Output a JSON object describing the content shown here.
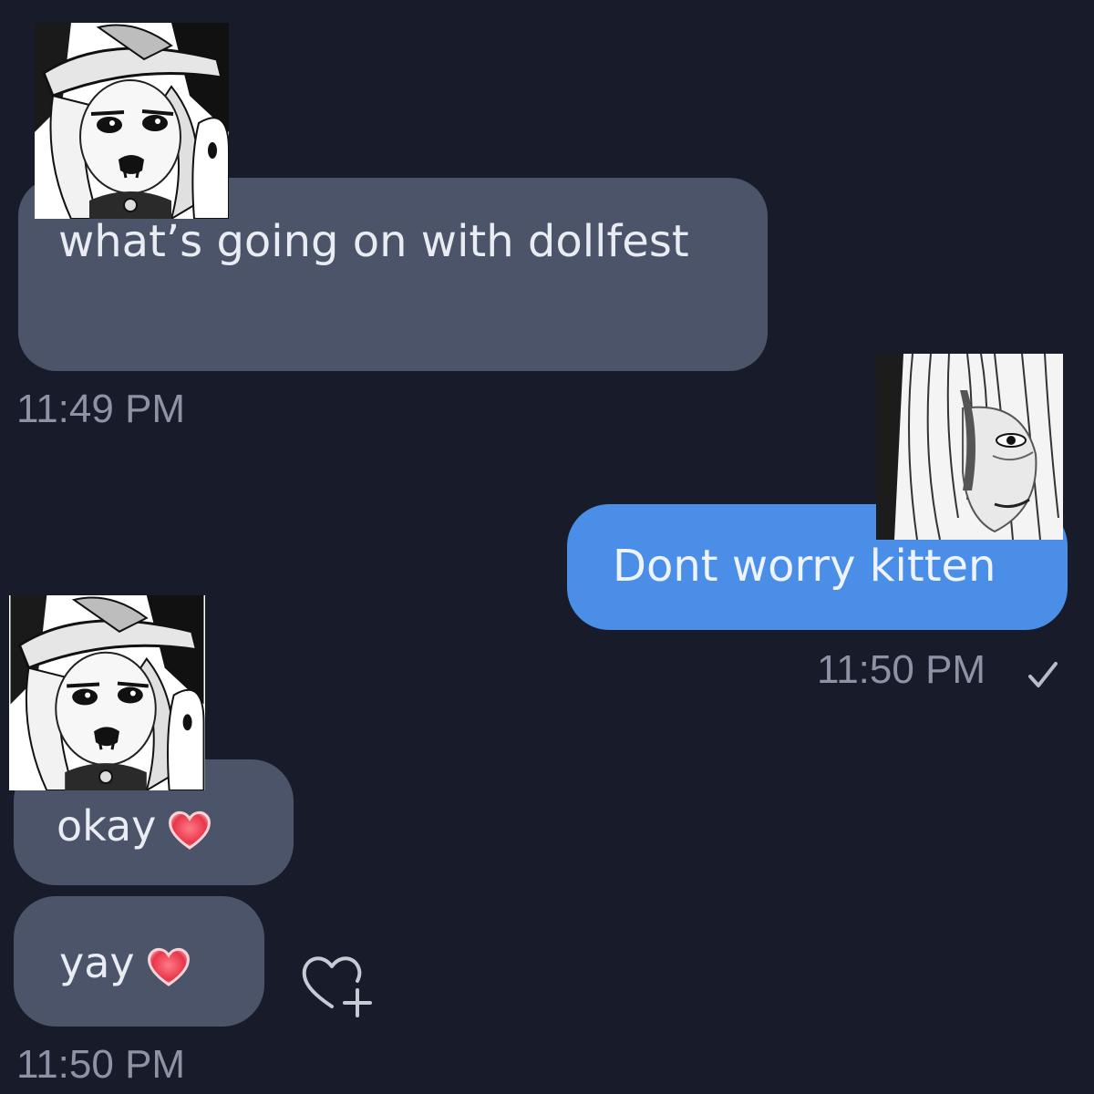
{
  "conversation": {
    "messages": [
      {
        "direction": "incoming",
        "text": "what’s going on with  dollfest"
      },
      {
        "direction": "outgoing",
        "text": "Dont worry kitten"
      },
      {
        "direction": "incoming",
        "text": "okay"
      },
      {
        "direction": "incoming",
        "text": "yay"
      }
    ],
    "timestamps": {
      "first": "11:49 PM",
      "second": "11:50 PM",
      "third": "11:50 PM"
    }
  },
  "icons": {
    "read_receipt": "check-icon",
    "heart": "red-heart-icon",
    "react": "heart-plus-icon"
  },
  "colors": {
    "background": "#181c2a",
    "incoming_bubble": "#4b5468",
    "outgoing_bubble": "#4a8ee8",
    "timestamp": "#8d93a4",
    "heart": "#e8344a"
  }
}
